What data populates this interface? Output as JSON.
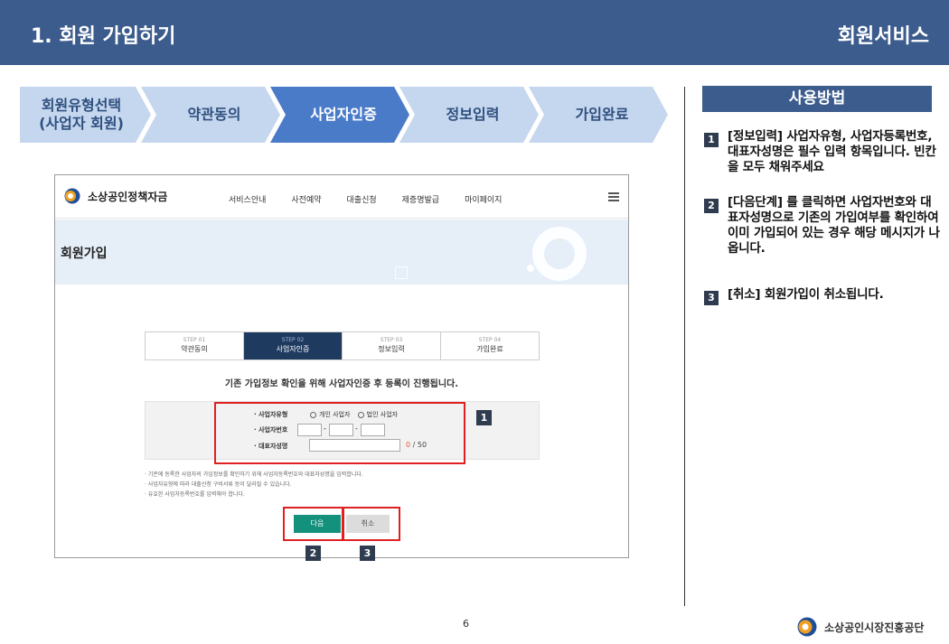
{
  "header": {
    "title": "1. 회원 가입하기",
    "service": "회원서비스"
  },
  "steps": [
    {
      "label": "회원유형선택\n(사업자 회원)",
      "active": false
    },
    {
      "label": "약관동의",
      "active": false
    },
    {
      "label": "사업자인증",
      "active": true
    },
    {
      "label": "정보입력",
      "active": false
    },
    {
      "label": "가입완료",
      "active": false
    }
  ],
  "colors": {
    "header": "#3c5c8d",
    "step_inactive": "#c5d7ee",
    "step_active": "#4a7bc8",
    "highlight": "#e02020",
    "next_button": "#14917c"
  },
  "usage": {
    "title": "사용방법",
    "notes": [
      {
        "num": "1",
        "text": "[정보입력] 사업자유형, 사업자등록번호, 대표자성명은 필수 입력 항목입니다. 빈칸을 모두 채워주세요"
      },
      {
        "num": "2",
        "text": "[다음단계] 를 클릭하면 사업자번호와 대표자성명으로 기존의 가입여부를 확인하여 이미 가입되어 있는 경우 해당 메시지가 나옵니다."
      },
      {
        "num": "3",
        "text": "[취소] 회원가입이 취소됩니다."
      }
    ]
  },
  "screenshot": {
    "brand": "소상공인정책자금",
    "menu": [
      "서비스안내",
      "사전예약",
      "대출신청",
      "제증명발급",
      "마이페이지"
    ],
    "page_title": "회원가입",
    "mini_steps": [
      {
        "step": "STEP 01",
        "name": "약관동의",
        "active": false
      },
      {
        "step": "STEP 02",
        "name": "사업자인증",
        "active": true
      },
      {
        "step": "STEP 03",
        "name": "정보입력",
        "active": false
      },
      {
        "step": "STEP 04",
        "name": "가입완료",
        "active": false
      }
    ],
    "info": "기존 가입정보 확인을 위해 사업자인증 후 등록이 진행됩니다.",
    "form": {
      "type_label": "· 사업자유형",
      "type_options": [
        "개인 사업자",
        "법인 사업자"
      ],
      "regno_label": "· 사업자번호",
      "rep_label": "· 대표자성명",
      "counter_current": "0",
      "counter_max": "/ 50"
    },
    "hints": [
      "· 기존에 등록한 사업자의 가입정보를 확인하기 위해 사업자등록번호와 대표자성명을 입력합니다.",
      "· 사업자유형에 따라 대출신청 구비서류 등이 달라질 수 있습니다.",
      "· 유효한 사업자등록번호를 입력해야 합니다."
    ],
    "next_label": "다음",
    "cancel_label": "취소",
    "marks": [
      "1",
      "2",
      "3"
    ]
  },
  "footer": {
    "page": "6",
    "org": "소상공인시장진흥공단"
  }
}
